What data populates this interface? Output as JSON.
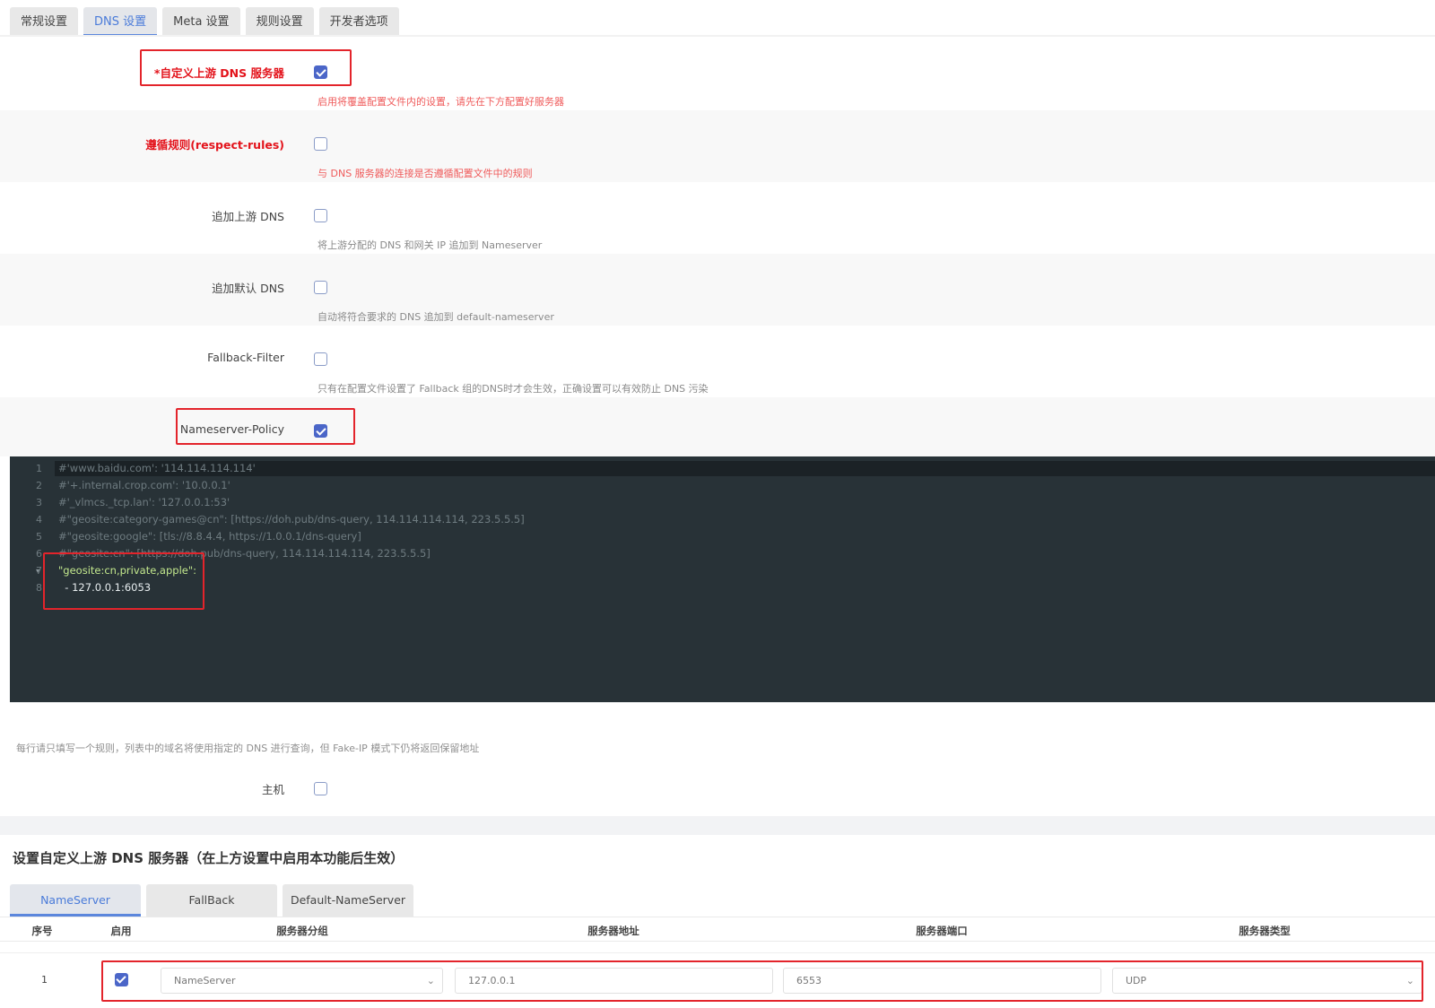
{
  "tabs": [
    "常规设置",
    "DNS 设置",
    "Meta 设置",
    "规则设置",
    "开发者选项"
  ],
  "settings": [
    {
      "label": "*自定义上游 DNS 服务器",
      "desc": "启用将覆盖配置文件内的设置，请先在下方配置好服务器",
      "checked": true
    },
    {
      "label": "遵循规则(respect-rules)",
      "desc": "与 DNS 服务器的连接是否遵循配置文件中的规则",
      "checked": false
    },
    {
      "label": "追加上游 DNS",
      "desc": "将上游分配的 DNS 和网关 IP 追加到 Nameserver",
      "checked": false
    },
    {
      "label": "追加默认 DNS",
      "desc": "自动将符合要求的 DNS 追加到 default-nameserver",
      "checked": false
    },
    {
      "label": "Fallback-Filter",
      "desc": "只有在配置文件设置了 Fallback 组的DNS时才会生效，正确设置可以有效防止 DNS 污染",
      "checked": false
    },
    {
      "label": "Nameserver-Policy",
      "desc": "",
      "checked": true
    }
  ],
  "editor": {
    "line_numbers": [
      "1",
      "2",
      "3",
      "4",
      "5",
      "6",
      "7",
      "8"
    ],
    "lines": [
      "#'www.baidu.com': '114.114.114.114'",
      "#'+.internal.crop.com': '10.0.0.1'",
      "#'_vlmcs._tcp.lan': '127.0.0.1:53'",
      "#\"geosite:category-games@cn\": [https://doh.pub/dns-query, 114.114.114.114, 223.5.5.5]",
      "#\"geosite:google\": [tls://8.8.4.4, https://1.0.0.1/dns-query]",
      "#\"geosite:cn\": [https://doh.pub/dns-query, 114.114.114.114, 223.5.5.5]",
      "\"geosite:cn,private,apple\":",
      "  - 127.0.0.1:6053"
    ]
  },
  "hint": "每行请只填写一个规则，列表中的域名将使用指定的 DNS 进行查询，但 Fake-IP 模式下仍将返回保留地址",
  "host": {
    "label": "主机",
    "checked": false
  },
  "section_title": "设置自定义上游 DNS 服务器（在上方设置中启用本功能后生效）",
  "subtabs": [
    "NameServer",
    "FallBack",
    "Default-NameServer"
  ],
  "table": {
    "headers": [
      "序号",
      "启用",
      "服务器分组",
      "服务器地址",
      "服务器端口",
      "服务器类型"
    ],
    "row": {
      "index": "1",
      "enabled": true,
      "group": "NameServer",
      "address": "127.0.0.1",
      "port": "6553",
      "type": "UDP"
    }
  }
}
